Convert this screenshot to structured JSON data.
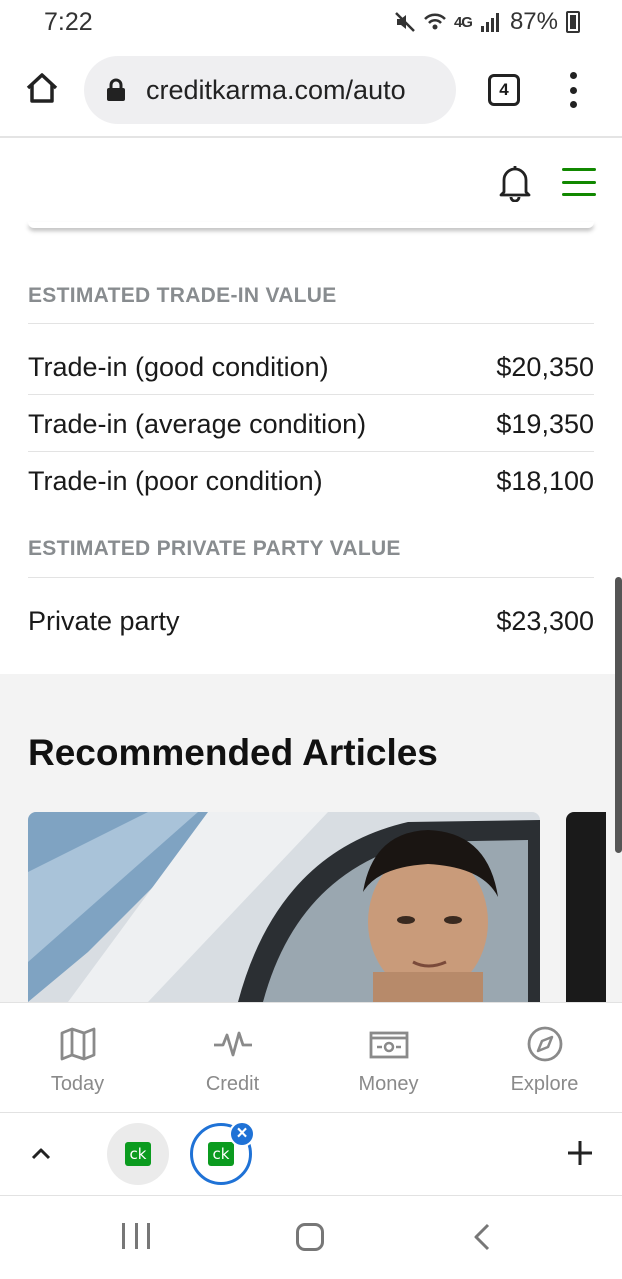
{
  "status_bar": {
    "time": "7:22",
    "network": "4G",
    "battery": "87%"
  },
  "browser": {
    "url": "creditkarma.com/auto",
    "tab_count": "4"
  },
  "trade_in": {
    "heading": "ESTIMATED TRADE-IN VALUE",
    "rows": [
      {
        "label": "Trade-in (good condition)",
        "value": "$20,350"
      },
      {
        "label": "Trade-in (average condition)",
        "value": "$19,350"
      },
      {
        "label": "Trade-in (poor condition)",
        "value": "$18,100"
      }
    ]
  },
  "private_party": {
    "heading": "ESTIMATED PRIVATE PARTY VALUE",
    "rows": [
      {
        "label": "Private party",
        "value": "$23,300"
      }
    ]
  },
  "articles": {
    "title": "Recommended Articles"
  },
  "app_nav": {
    "items": [
      {
        "label": "Today",
        "icon": "map-icon"
      },
      {
        "label": "Credit",
        "icon": "pulse-icon"
      },
      {
        "label": "Money",
        "icon": "banknote-icon"
      },
      {
        "label": "Explore",
        "icon": "compass-icon"
      }
    ]
  },
  "tab_strip": {
    "tabs": [
      {
        "badge": "ck"
      },
      {
        "badge": "ck"
      }
    ]
  },
  "colors": {
    "brand_green": "#118800",
    "heading_gray": "#888c8f",
    "tab_blue": "#1f72d6"
  }
}
